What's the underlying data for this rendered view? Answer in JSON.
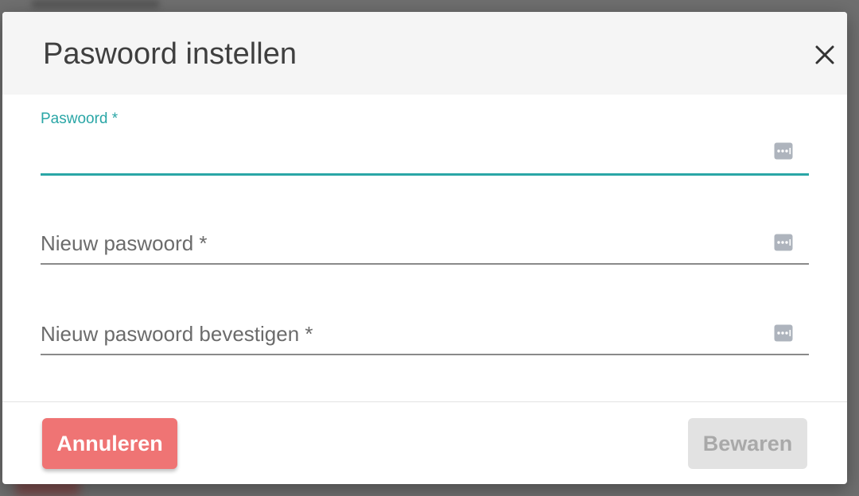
{
  "dialog": {
    "title": "Paswoord instellen",
    "close_icon": "close-icon"
  },
  "fields": {
    "current": {
      "label": "Paswoord *",
      "value": "",
      "icon": "password-dots-icon",
      "focused": true
    },
    "new": {
      "placeholder": "Nieuw paswoord *",
      "value": "",
      "icon": "password-dots-icon"
    },
    "confirm": {
      "placeholder": "Nieuw paswoord bevestigen *",
      "value": "",
      "icon": "password-dots-icon"
    }
  },
  "footer": {
    "cancel_label": "Annuleren",
    "save_label": "Bewaren",
    "save_disabled": true
  },
  "colors": {
    "accent": "#2aa6a6",
    "cancel": "#ef7474",
    "disabled_bg": "#e2e2e2",
    "disabled_text": "#a9a9a9"
  }
}
